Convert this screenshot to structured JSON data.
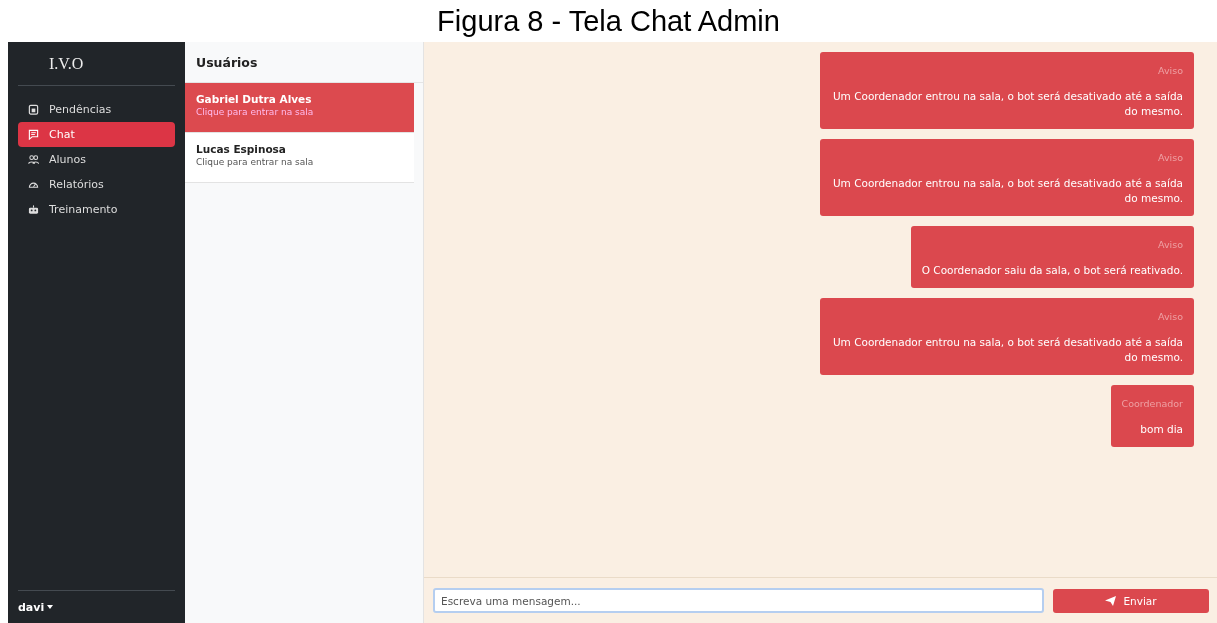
{
  "caption": "Figura 8 - Tela Chat Admin",
  "sidebar": {
    "brand": "I.V.O",
    "items": [
      {
        "label": "Pendências",
        "selected": false
      },
      {
        "label": "Chat",
        "selected": true
      },
      {
        "label": "Alunos",
        "selected": false
      },
      {
        "label": "Relatórios",
        "selected": false
      },
      {
        "label": "Treinamento",
        "selected": false
      }
    ],
    "user": "davi"
  },
  "users": {
    "title": "Usuários",
    "items": [
      {
        "name": "Gabriel Dutra Alves",
        "hint": "Clique para entrar na sala",
        "selected": true
      },
      {
        "name": "Lucas Espinosa",
        "hint": "Clique para entrar na sala",
        "selected": false
      }
    ]
  },
  "messages": [
    {
      "sender": "Aviso",
      "text": "Um Coordenador entrou na sala, o bot será desativado até a saída do mesmo."
    },
    {
      "sender": "Aviso",
      "text": "Um Coordenador entrou na sala, o bot será desativado até a saída do mesmo."
    },
    {
      "sender": "Aviso",
      "text": "O Coordenador saiu da sala, o bot será reativado."
    },
    {
      "sender": "Aviso",
      "text": "Um Coordenador entrou na sala, o bot será desativado até a saída do mesmo."
    },
    {
      "sender": "Coordenador",
      "text": "bom dia"
    }
  ],
  "composer": {
    "placeholder": "Escreva uma mensagem...",
    "button": "Enviar"
  }
}
